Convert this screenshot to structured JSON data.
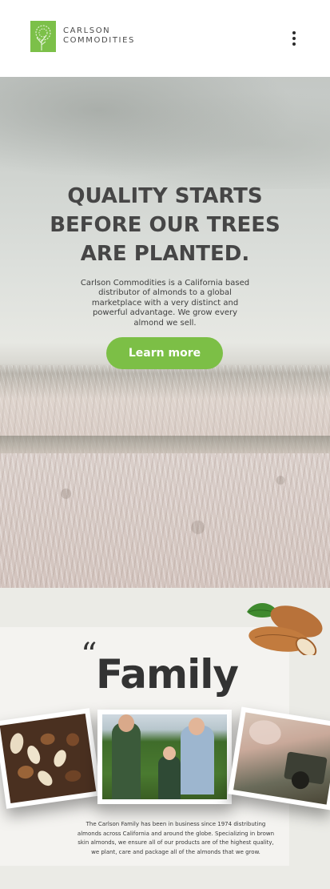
{
  "header": {
    "logo_line1": "CARLSON",
    "logo_line2": "COMMODITIES",
    "menu_icon": "kebab-menu-icon"
  },
  "hero": {
    "title_line1": "QUALITY STARTS",
    "title_line2": "BEFORE OUR TREES",
    "title_line3": "ARE PLANTED.",
    "description": "Carlson Commodities is a California based distributor of almonds to a global marketplace with a very distinct and powerful advantage. We grow every almond we sell.",
    "cta_label": "Learn more"
  },
  "family": {
    "quote_mark": "“",
    "title": "Family",
    "description": "The Carlson Family has been in business since 1974 distributing almonds across California and around the globe. Specializing in brown skin almonds, we ensure all of our products are of the highest quality, we plant, care and package all of the almonds that we grow."
  },
  "colors": {
    "brand_green": "#7cbf46",
    "heading": "#464646",
    "header_bg": "#ffffff",
    "section_bg": "#ebebe6"
  }
}
